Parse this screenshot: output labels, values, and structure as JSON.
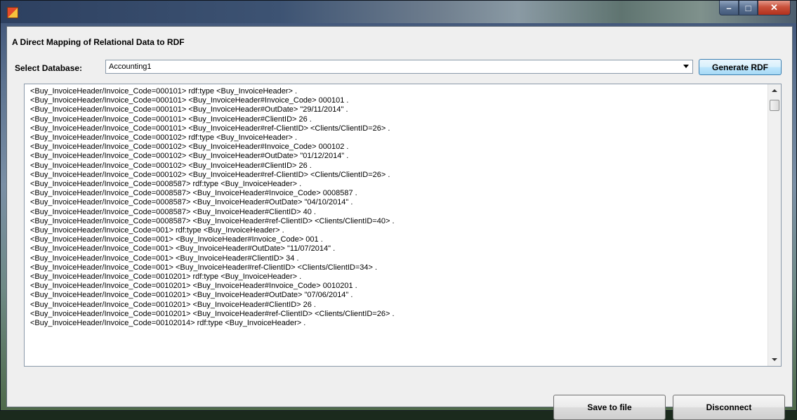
{
  "window": {
    "minimize_glyph": "–",
    "maximize_glyph": "□",
    "close_glyph": "✕",
    "close_color": "#c9513b"
  },
  "header": {
    "title": "A Direct Mapping of Relational Data to RDF"
  },
  "database": {
    "label": "Select Database:",
    "selected": "Accounting1"
  },
  "buttons": {
    "generate": "Generate RDF",
    "save": "Save to file",
    "disconnect": "Disconnect"
  },
  "output": {
    "lines": [
      "<Buy_InvoiceHeader/Invoice_Code=000101> rdf:type <Buy_InvoiceHeader> .",
      "<Buy_InvoiceHeader/Invoice_Code=000101> <Buy_InvoiceHeader#Invoice_Code> 000101 .",
      "<Buy_InvoiceHeader/Invoice_Code=000101> <Buy_InvoiceHeader#OutDate> \"29/11/2014\" .",
      "<Buy_InvoiceHeader/Invoice_Code=000101> <Buy_InvoiceHeader#ClientID> 26 .",
      "<Buy_InvoiceHeader/Invoice_Code=000101> <Buy_InvoiceHeader#ref-ClientID> <Clients/ClientID=26> .",
      "<Buy_InvoiceHeader/Invoice_Code=000102> rdf:type <Buy_InvoiceHeader> .",
      "<Buy_InvoiceHeader/Invoice_Code=000102> <Buy_InvoiceHeader#Invoice_Code> 000102 .",
      "<Buy_InvoiceHeader/Invoice_Code=000102> <Buy_InvoiceHeader#OutDate> \"01/12/2014\" .",
      "<Buy_InvoiceHeader/Invoice_Code=000102> <Buy_InvoiceHeader#ClientID> 26 .",
      "<Buy_InvoiceHeader/Invoice_Code=000102> <Buy_InvoiceHeader#ref-ClientID> <Clients/ClientID=26> .",
      "<Buy_InvoiceHeader/Invoice_Code=0008587> rdf:type <Buy_InvoiceHeader> .",
      "<Buy_InvoiceHeader/Invoice_Code=0008587> <Buy_InvoiceHeader#Invoice_Code> 0008587 .",
      "<Buy_InvoiceHeader/Invoice_Code=0008587> <Buy_InvoiceHeader#OutDate> \"04/10/2014\" .",
      "<Buy_InvoiceHeader/Invoice_Code=0008587> <Buy_InvoiceHeader#ClientID> 40 .",
      "<Buy_InvoiceHeader/Invoice_Code=0008587> <Buy_InvoiceHeader#ref-ClientID> <Clients/ClientID=40> .",
      "<Buy_InvoiceHeader/Invoice_Code=001> rdf:type <Buy_InvoiceHeader> .",
      "<Buy_InvoiceHeader/Invoice_Code=001> <Buy_InvoiceHeader#Invoice_Code> 001 .",
      "<Buy_InvoiceHeader/Invoice_Code=001> <Buy_InvoiceHeader#OutDate> \"11/07/2014\" .",
      "<Buy_InvoiceHeader/Invoice_Code=001> <Buy_InvoiceHeader#ClientID> 34 .",
      "<Buy_InvoiceHeader/Invoice_Code=001> <Buy_InvoiceHeader#ref-ClientID> <Clients/ClientID=34> .",
      "<Buy_InvoiceHeader/Invoice_Code=0010201> rdf:type <Buy_InvoiceHeader> .",
      "<Buy_InvoiceHeader/Invoice_Code=0010201> <Buy_InvoiceHeader#Invoice_Code> 0010201 .",
      "<Buy_InvoiceHeader/Invoice_Code=0010201> <Buy_InvoiceHeader#OutDate> \"07/06/2014\" .",
      "<Buy_InvoiceHeader/Invoice_Code=0010201> <Buy_InvoiceHeader#ClientID> 26 .",
      "<Buy_InvoiceHeader/Invoice_Code=0010201> <Buy_InvoiceHeader#ref-ClientID> <Clients/ClientID=26> .",
      "<Buy_InvoiceHeader/Invoice_Code=00102014> rdf:type <Buy_InvoiceHeader> ."
    ]
  }
}
